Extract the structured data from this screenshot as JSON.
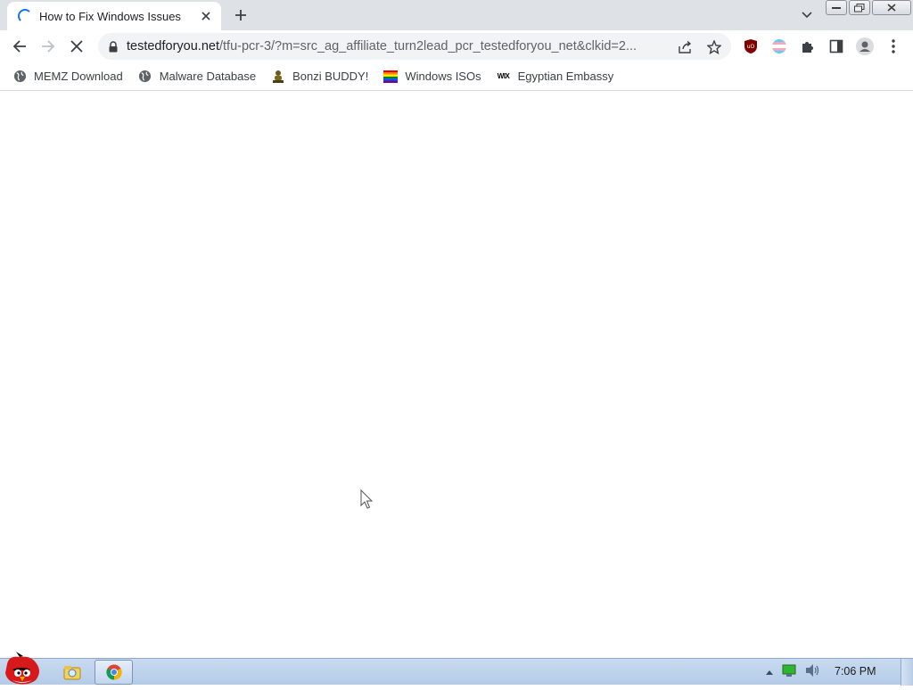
{
  "browser": {
    "tab": {
      "title": "How to Fix Windows Issues",
      "loading": true
    },
    "url": {
      "host": "testedforyou.net",
      "path": "/tfu-pcr-3/?m=src_ag_affiliate_turn2lead_pcr_testedforyou_net&clkid=2..."
    },
    "icons": {
      "back": "arrow-left-icon",
      "forward": "arrow-right-icon",
      "stop": "close-icon",
      "lock": "lock-icon",
      "share": "share-icon",
      "bookmark_star": "star-icon",
      "extensions": [
        "ublock-icon",
        "trans-flag-icon",
        "puzzle-icon",
        "side-panel-icon",
        "profile-icon",
        "kebab-menu-icon"
      ]
    },
    "bookmarks": [
      {
        "label": "MEMZ Download",
        "icon": "globe-icon"
      },
      {
        "label": "Malware Database",
        "icon": "globe-icon"
      },
      {
        "label": "Bonzi BUDDY!",
        "icon": "bonzi-icon"
      },
      {
        "label": "Windows ISOs",
        "icon": "rainbow-flag-icon"
      },
      {
        "label": "Egyptian Embassy",
        "icon": "wix-icon"
      }
    ],
    "wix_logo_text": "WIX"
  },
  "taskbar": {
    "clock": "7:06 PM",
    "apps": [
      "angry-bird-start-icon",
      "explorer-icon",
      "chrome-icon"
    ],
    "tray": [
      "show-hidden-icons-icon",
      "network-icon",
      "volume-icon"
    ]
  },
  "colors": {
    "accent": "#1a73e8",
    "tabstrip": "#dee1e6",
    "omnibox": "#f1f3f4",
    "taskbar": "#b4cbe8"
  }
}
